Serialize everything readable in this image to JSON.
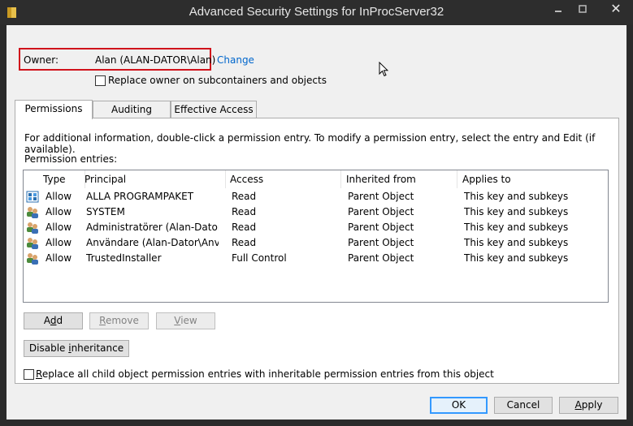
{
  "window": {
    "title": "Advanced Security Settings for InProcServer32",
    "close_label": "✕"
  },
  "owner": {
    "label": "Owner:",
    "value": "Alan (ALAN-DATOR\\Alan)",
    "change_link": "Change"
  },
  "replace_owner": {
    "label": "Replace owner on subcontainers and objects",
    "checked": false
  },
  "tabs": [
    {
      "label": "Permissions",
      "active": true
    },
    {
      "label": "Auditing"
    },
    {
      "label": "Effective Access"
    }
  ],
  "panel": {
    "info": "For additional information, double-click a permission entry. To modify a permission entry, select the entry and Edit (if available).",
    "entries_label": "Permission entries:"
  },
  "columns": [
    "Type",
    "Principal",
    "Access",
    "Inherited from",
    "Applies to"
  ],
  "entries": [
    {
      "icon": "package-group-icon",
      "type": "Allow",
      "principal": "ALLA PROGRAMPAKET",
      "access": "Read",
      "inherited_from": "Parent Object",
      "applies_to": "This key and subkeys"
    },
    {
      "icon": "users-group-icon",
      "type": "Allow",
      "principal": "SYSTEM",
      "access": "Read",
      "inherited_from": "Parent Object",
      "applies_to": "This key and subkeys"
    },
    {
      "icon": "users-group-icon",
      "type": "Allow",
      "principal": "Administratörer (Alan-Dator\\...",
      "access": "Read",
      "inherited_from": "Parent Object",
      "applies_to": "This key and subkeys"
    },
    {
      "icon": "users-group-icon",
      "type": "Allow",
      "principal": "Användare (Alan-Dator\\Anvä...",
      "access": "Read",
      "inherited_from": "Parent Object",
      "applies_to": "This key and subkeys"
    },
    {
      "icon": "users-group-icon",
      "type": "Allow",
      "principal": "TrustedInstaller",
      "access": "Full Control",
      "inherited_from": "Parent Object",
      "applies_to": "This key and subkeys"
    }
  ],
  "buttons": {
    "add": {
      "pre": "A",
      "ul": "d",
      "post": "d"
    },
    "remove": {
      "pre": "",
      "ul": "R",
      "post": "emove"
    },
    "view": {
      "pre": "",
      "ul": "V",
      "post": "iew"
    },
    "disable_inheritance": {
      "pre": "Disable ",
      "ul": "i",
      "post": "nheritance"
    },
    "ok": "OK",
    "cancel": "Cancel",
    "apply": {
      "pre": "",
      "ul": "A",
      "post": "pply"
    }
  },
  "replace_children": {
    "pre": "",
    "ul": "R",
    "post": "eplace all child object permission entries with inheritable permission entries from this object",
    "checked": false
  }
}
